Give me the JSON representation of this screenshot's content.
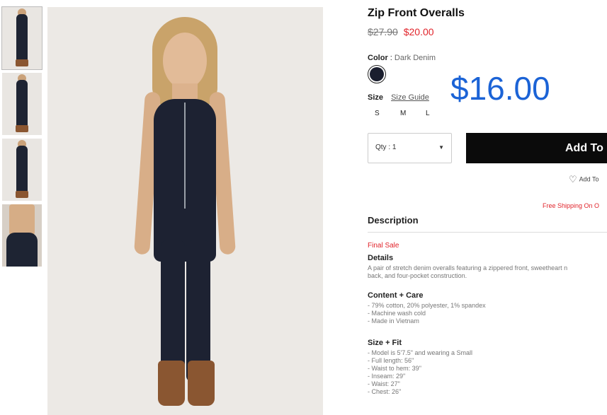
{
  "product": {
    "title": "Zip Front Overalls",
    "price_original": "$27.90",
    "price_sale": "$20.00",
    "color_label": "Color",
    "color_separator": ":",
    "color_value": "Dark Denim",
    "size_label": "Size",
    "size_guide": "Size Guide",
    "sizes": [
      "S",
      "M",
      "L"
    ],
    "overlay_price": "$16.00"
  },
  "purchase": {
    "qty_label": "Qty : 1",
    "add_button": "Add To",
    "wishlist": "Add To",
    "shipping_note": "Free Shipping On O"
  },
  "description": {
    "heading": "Description",
    "final_sale": "Final Sale",
    "details_heading": "Details",
    "details_text_1": "A pair of stretch denim overalls featuring a zippered front, sweetheart n",
    "details_text_2": "back, and four-pocket construction.",
    "content_heading": "Content + Care",
    "content_items": [
      "- 79% cotton, 20% polyester, 1% spandex",
      "- Machine wash cold",
      "- Made in Vietnam"
    ],
    "fit_heading": "Size + Fit",
    "fit_items": [
      "- Model is 5'7.5\" and wearing a Small",
      "- Full length: 56\"",
      "- Waist to hem: 39\"",
      "- Inseam: 29\"",
      "- Waist: 27\"",
      "- Chest: 26\""
    ]
  },
  "colors": {
    "sale_red": "#e1242b",
    "overlay_blue": "#1b63d6",
    "button_black": "#0b0b0b",
    "denim": "#1d2232"
  },
  "icons": {
    "wishlist": "heart-outline-icon",
    "qty_dropdown": "caret-down-icon"
  }
}
